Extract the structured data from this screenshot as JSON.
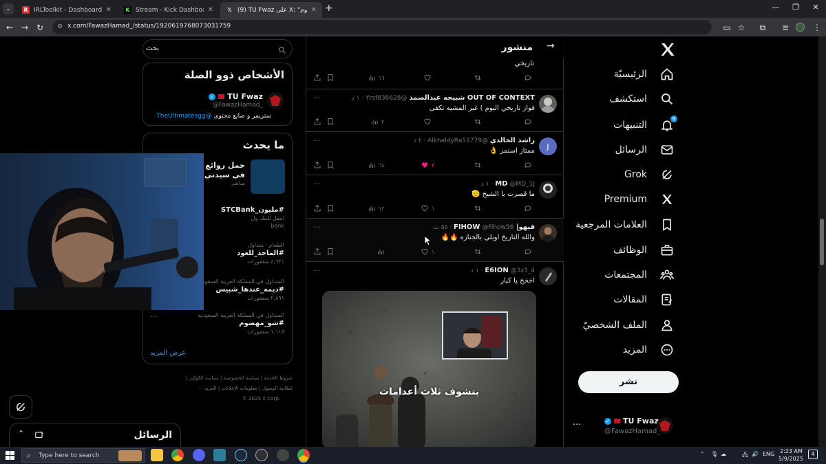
{
  "browser": {
    "tabs": [
      {
        "title": "IRLToolkit - Dashboard",
        "active": false
      },
      {
        "title": "Stream - Kick Dashboard",
        "active": false
      },
      {
        "title": "(9) TU Fwaz على X: \"حاكم اليوم",
        "active": true
      }
    ],
    "url": "x.com/FawazHamad_/status/1920619768073031759"
  },
  "nav": {
    "items": [
      {
        "label": "الرئيسيّة",
        "icon": "home-icon"
      },
      {
        "label": "استكشف",
        "icon": "search-icon"
      },
      {
        "label": "التنبيهات",
        "icon": "bell-icon",
        "badge": "9"
      },
      {
        "label": "الرسائل",
        "icon": "mail-icon"
      },
      {
        "label": "Grok",
        "icon": "grok-icon"
      },
      {
        "label": "Premium",
        "icon": "x-logo-icon"
      },
      {
        "label": "العلامات المرجعية",
        "icon": "bookmark-icon"
      },
      {
        "label": "الوظائف",
        "icon": "briefcase-icon"
      },
      {
        "label": "المجتمعات",
        "icon": "communities-icon"
      },
      {
        "label": "المقالات",
        "icon": "articles-icon"
      },
      {
        "label": "الملف الشخصيّ",
        "icon": "profile-icon"
      },
      {
        "label": "المزيد",
        "icon": "more-circle-icon"
      }
    ],
    "post_button": "نشر",
    "account": {
      "name": "TU Fwaz",
      "handle": "@FawazHamad_"
    }
  },
  "timeline": {
    "header_title": "منشور",
    "top_text": "تاريخي",
    "top_views": "١٦",
    "replies": [
      {
        "name": "OUT OF CONTEXT شبيحه عبدالصمد",
        "handle": "@Yrsf836628",
        "time": "١ د",
        "text": "فواز تاريخي اليوم ) غير المشيه تكفى",
        "likes": "",
        "retweets": "",
        "replies_count": "",
        "views": "٢",
        "liked": false
      },
      {
        "name": "راشد الخالدي",
        "handle": "@AlkhaldyRa51779",
        "time": "٢ د",
        "text": "ممتاز استمر 👌",
        "likes": "٢",
        "retweets": "",
        "replies_count": "",
        "views": "٦٤",
        "liked": true,
        "avatar_letter": "J"
      },
      {
        "name": "MD",
        "handle": "@MD_1J",
        "time": "١ د",
        "text": "ما قصرت يا الشيخ 🫡",
        "likes": "١",
        "retweets": "",
        "replies_count": "",
        "views": "١٢",
        "liked": false
      },
      {
        "name": "فيهو| FIHOW",
        "handle": "@Fihow56",
        "time": "٥٥ ث",
        "text": "والله التاريخ اوبلي بالجنازه 🔥🔥",
        "likes": "١",
        "retweets": "",
        "replies_count": "",
        "views": "",
        "liked": false
      },
      {
        "name": "E6ION",
        "handle": "@3z3_4",
        "time": "١ د",
        "text": "اخخخ يا كبار",
        "likes": "",
        "retweets": "",
        "replies_count": "",
        "views": "",
        "liked": false
      }
    ],
    "media_caption": "بتشوف ثلاث أعدامات"
  },
  "right": {
    "search_placeholder": "بحث",
    "people": {
      "title": "الأشخاص ذوو الصلة",
      "name": "TU Fwaz",
      "handle": "@FawazHamad_",
      "bio_prefix": "ستريمر و صانع محتوى",
      "bio_link": "@TheUltimatesgg"
    },
    "trending": {
      "title": "ما يحدث",
      "promo": {
        "line1": "حمل روائع الأو",
        "line2": "في سيدني",
        "meta": "مباشر"
      },
      "items": [
        {
          "meta": "",
          "tag": "#مليون_STCBank",
          "sub": "انتقل للبنك ول",
          "count": "bank"
        },
        {
          "meta": "الطعام · متداول",
          "tag": "#الماجد_للعود",
          "count": "٤,٦٢١ منشورات"
        },
        {
          "meta": "المتداول في المملكة العربية السعودية",
          "tag": "#ديمه_عندها_شبيس",
          "count": "٢,٨٩١ منشورات"
        },
        {
          "meta": "المتداول في المملكة العربية السعودية",
          "tag": "#شو_مهضوم",
          "count": "١,١١٥ منشورات"
        }
      ],
      "show_more": "عرض المزيد"
    },
    "footer": {
      "line1": "شروط الخدمة | سياسة الخصوصية | سياسة الكوكيز |",
      "line2": "إمكانية الوصول | معلومات الإعلانات | المزيد ···",
      "line3": "© 2025 X Corp."
    }
  },
  "messages": {
    "title": "الرسائل"
  },
  "taskbar": {
    "search_placeholder": "Type here to search",
    "time": "2:23 AM",
    "date": "5/9/2025",
    "lang": "ENG",
    "notif_count": "4"
  },
  "colors": {
    "accent": "#1d9bf0",
    "like": "#f91880",
    "bg": "#000000",
    "border": "#2f3336"
  }
}
